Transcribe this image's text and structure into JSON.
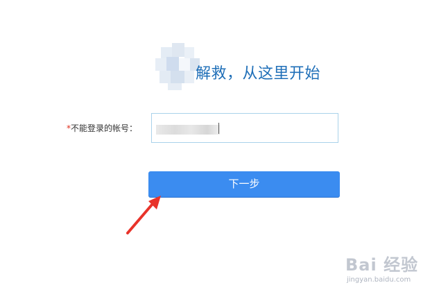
{
  "header": {
    "title": "解救，从这里开始",
    "logo_icon": "blurred-logo-icon"
  },
  "form": {
    "required_mark": "*",
    "account_label": "不能登录的帐号：",
    "account_value_masked": true
  },
  "actions": {
    "next_label": "下一步"
  },
  "annotation": {
    "arrow_icon": "red-pointer-arrow-icon",
    "arrow_color": "#e8332a"
  },
  "watermark": {
    "logo_text": "Bai 经验",
    "url": "jingyan.baidu.com"
  },
  "colors": {
    "title": "#1f6fb8",
    "button": "#3b8cf0",
    "input_border": "#a9d2ea",
    "required": "#e0301e"
  }
}
